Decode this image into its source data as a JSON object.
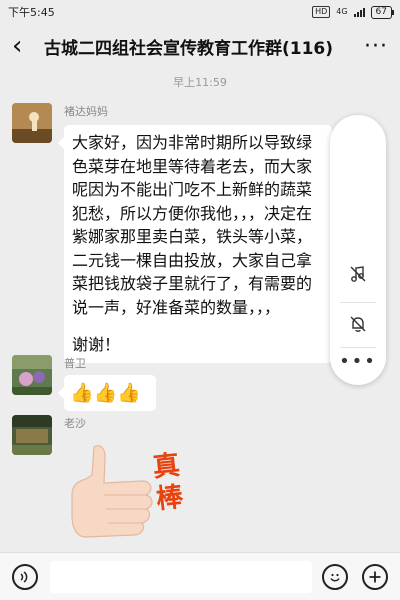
{
  "status": {
    "time": "下午5:45",
    "hd": "HD",
    "network": "4G",
    "battery": "67"
  },
  "header": {
    "back_glyph": "‹",
    "title": "古城二四组社会宣传教育工作群(116)",
    "more_glyph": "···"
  },
  "chat": {
    "timestamp": "早上11:59",
    "messages": [
      {
        "sender": "褚达妈妈",
        "lines": [
          "大家好，因为非常时期所以导致绿",
          "色菜芽在地里等待着老去，而大家",
          "呢因为不能出门吃不上新鲜的蔬菜",
          "犯愁，所以方便你我他，，，决定在",
          "紫娜家那里卖白菜，铁头等小菜，",
          "二元钱一棵自由投放，大家自己拿",
          "菜把钱放袋子里就行了，有需要的",
          "说一声，好准备菜的数量，，，",
          "",
          "谢谢！"
        ]
      },
      {
        "sender": "普卫",
        "emoji": [
          "👍",
          "👍",
          "👍"
        ]
      },
      {
        "sender": "老沙",
        "sticker_text": "真棒"
      }
    ]
  },
  "colors": {
    "background": "#ededed",
    "bubble": "#ffffff",
    "sticker_text": "#e8420f",
    "muted": "#999999"
  },
  "icons": {
    "float_panel": [
      "music-note-off-icon",
      "bell-off-icon",
      "more-dots-icon"
    ],
    "bottom": [
      "voice-icon",
      "emoji-icon",
      "add-icon"
    ]
  }
}
